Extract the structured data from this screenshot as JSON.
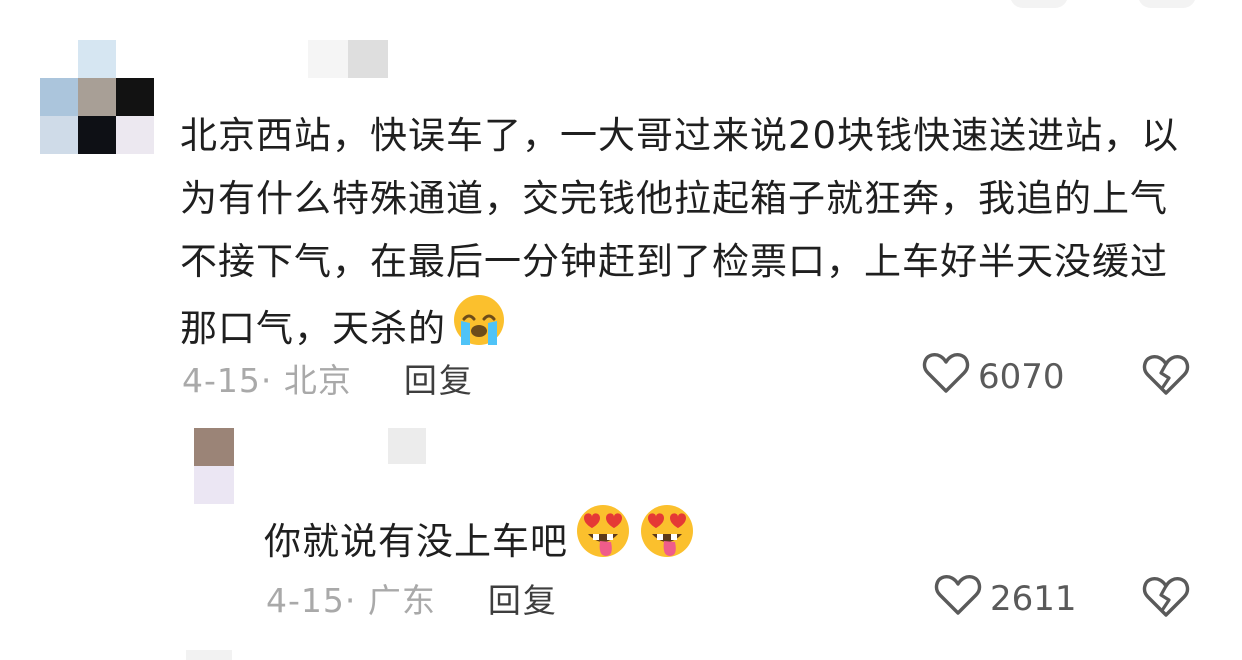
{
  "comment": {
    "text": "北京西站，快误车了，一大哥过来说20块钱快速送进站，以为有什么特殊通道，交完钱他拉起箱子就狂奔，我追的上气不接下气，在最后一分钟赶到了检票口，上车好半天没缓过那口气，天杀的",
    "emoji": "loudly-crying-face",
    "date_location": "4-15· 北京",
    "reply_label": "回复",
    "likes": "6070",
    "like_icon": "heart-outline-icon",
    "dislike_icon": "broken-heart-icon"
  },
  "reply": {
    "text": "你就说有没上车吧",
    "emojis": [
      "tongue-heart-eyes-face",
      "tongue-heart-eyes-face"
    ],
    "date_location": "4-15· 广东",
    "reply_label": "回复",
    "likes": "2611",
    "like_icon": "heart-outline-icon",
    "dislike_icon": "broken-heart-icon"
  },
  "colors": {
    "text": "#1f1f1f",
    "meta": "#a9a9a9",
    "reply_link": "#3e3e3e",
    "icon": "#5a5a5a",
    "crying_face": "#fbc02d",
    "tears": "#4fc3f7"
  }
}
